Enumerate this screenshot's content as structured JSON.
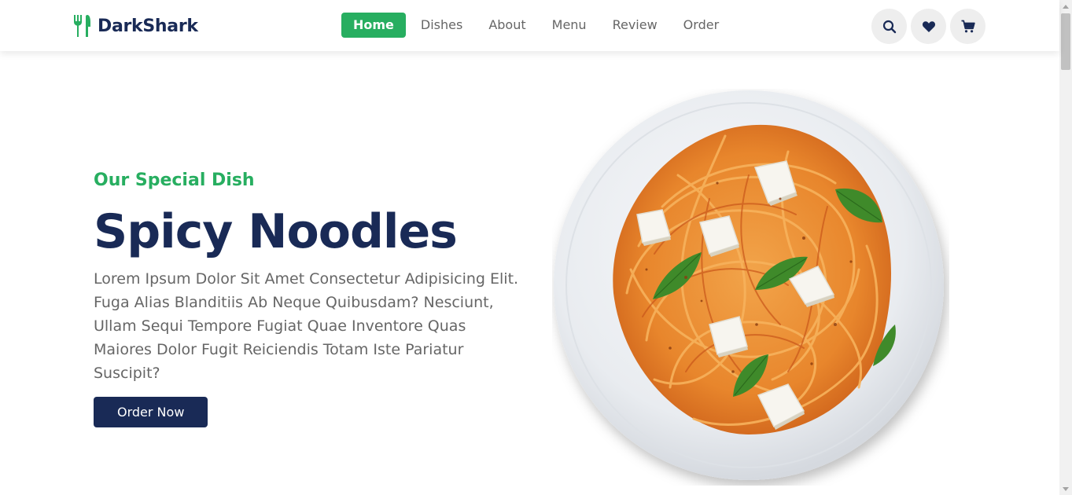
{
  "brand": {
    "name": "DarkShark",
    "icon": "utensils-icon",
    "accent_color": "#27ae60",
    "primary_color": "#192a56"
  },
  "nav": {
    "items": [
      {
        "label": "Home",
        "active": true
      },
      {
        "label": "Dishes",
        "active": false
      },
      {
        "label": "About",
        "active": false
      },
      {
        "label": "Menu",
        "active": false
      },
      {
        "label": "Review",
        "active": false
      },
      {
        "label": "Order",
        "active": false
      }
    ]
  },
  "header_icons": [
    "search-icon",
    "heart-icon",
    "cart-icon"
  ],
  "hero": {
    "subtitle": "Our Special Dish",
    "title": "Spicy Noodles",
    "description": "Lorem Ipsum Dolor Sit Amet Consectetur Adipisicing Elit. Fuga Alias Blanditiis Ab Neque Quibusdam? Nesciunt, Ullam Sequi Tempore Fugiat Quae Inventore Quas Maiores Dolor Fugit Reiciendis Totam Iste Pariatur Suscipit?",
    "button_label": "Order Now",
    "image": "spaghetti-plate-image"
  }
}
